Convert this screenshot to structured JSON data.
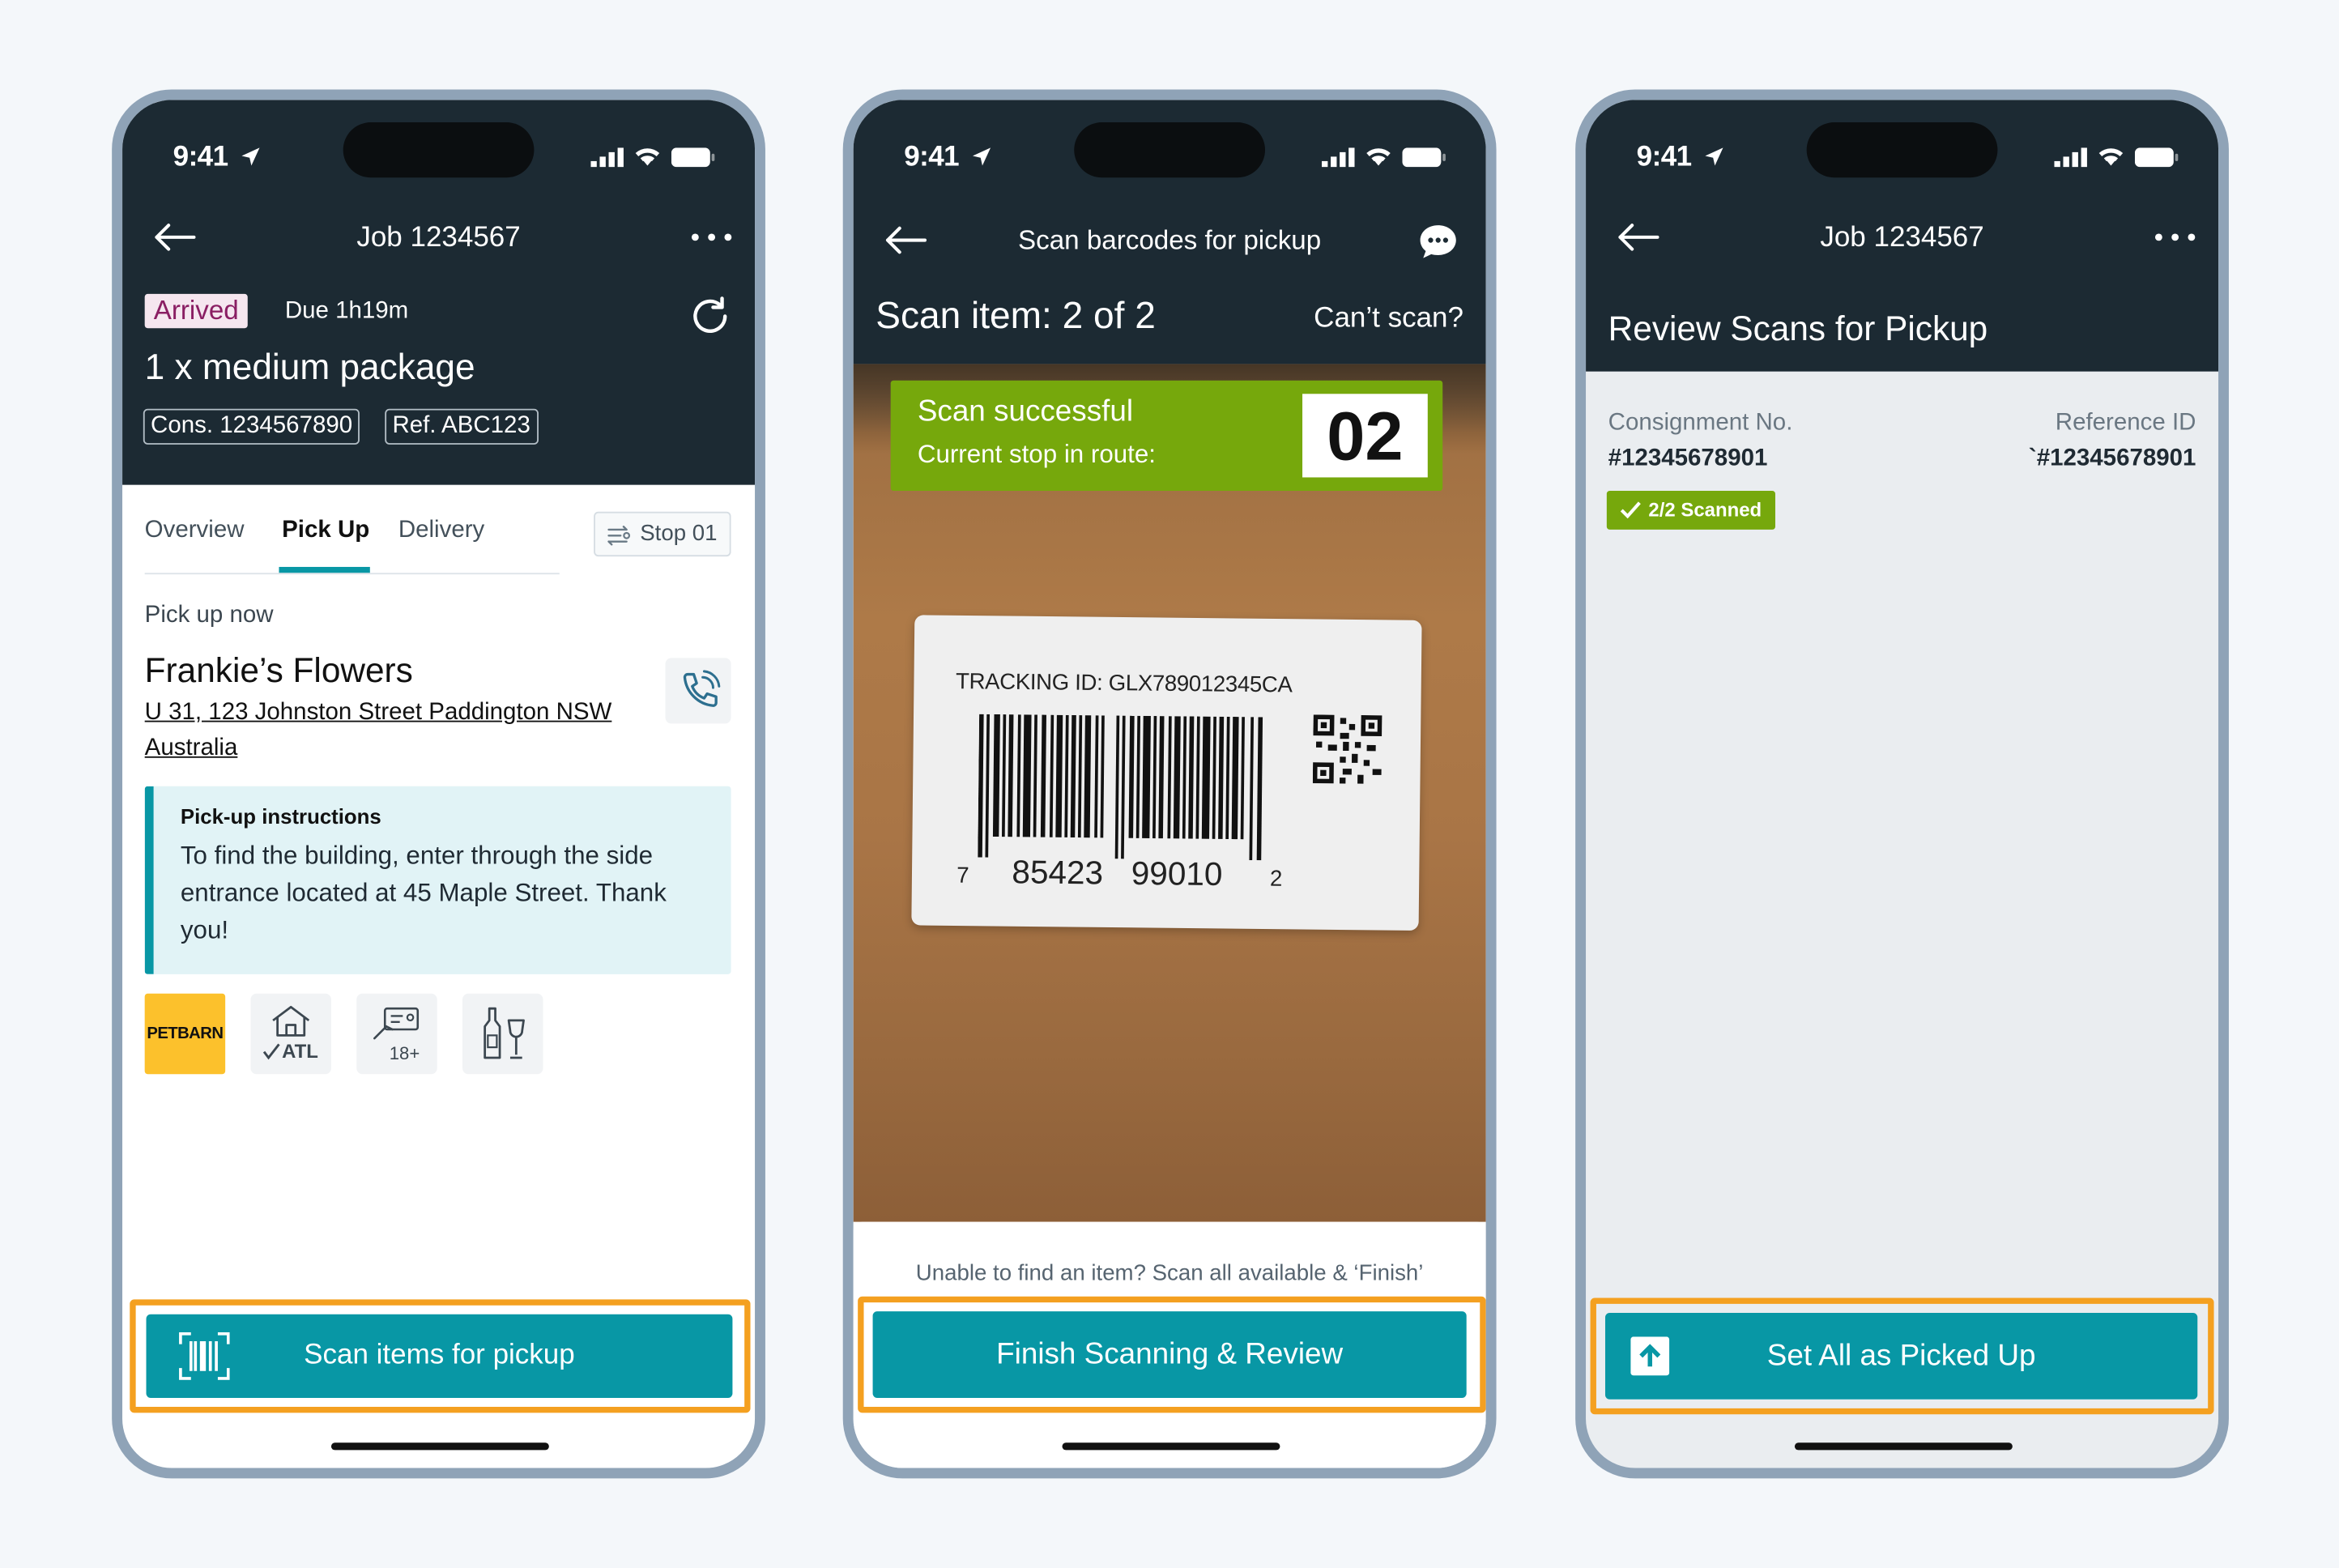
{
  "status": {
    "time": "9:41"
  },
  "screen1": {
    "title": "Job 1234567",
    "badge": "Arrived",
    "due": "Due 1h19m",
    "package": "1 x medium package",
    "cons": "Cons. 1234567890",
    "ref": "Ref. ABC123",
    "tabs": [
      "Overview",
      "Pick Up",
      "Delivery"
    ],
    "active_tab": "Pick Up",
    "stop": "Stop 01",
    "section": "Pick up now",
    "business": "Frankie’s Flowers",
    "address_line1": "U 31, 123 Johnston Street Paddington NSW",
    "address_line2": "Australia",
    "instructions_title": "Pick-up instructions",
    "instructions_text": "To find the building, enter through the side entrance located at 45 Maple Street. Thank you!",
    "tags": {
      "brand": "PETBARN",
      "atl": "ATL",
      "age": "18+",
      "wine": "wine-bottle-glass-icon"
    },
    "button": "Scan items for pickup"
  },
  "screen2": {
    "title": "Scan barcodes for pickup",
    "progress": "Scan item: 2 of 2",
    "cant_scan": "Can’t scan?",
    "success_title": "Scan successful",
    "success_sub": "Current stop in route:",
    "stop_number": "02",
    "tracking": "TRACKING ID: GLX789012345CA",
    "barcode_left": "7",
    "barcode_mid1": "85423",
    "barcode_mid2": "99010",
    "barcode_right": "2",
    "hint": "Unable to find an item? Scan all available & ‘Finish’",
    "button": "Finish Scanning & Review"
  },
  "screen3": {
    "title": "Job 1234567",
    "heading": "Review Scans for Pickup",
    "cons_label": "Consignment No.",
    "cons_value": "#12345678901",
    "ref_label": "Reference ID",
    "ref_value": "`#12345678901",
    "scanned": "2/2 Scanned",
    "button": "Set All as Picked Up"
  },
  "colors": {
    "teal": "#0897a5",
    "dark": "#1c2a33",
    "green": "#76a80c",
    "highlight": "#f4a020",
    "badge": "#8a1e63",
    "petbarn": "#fcc12c"
  }
}
